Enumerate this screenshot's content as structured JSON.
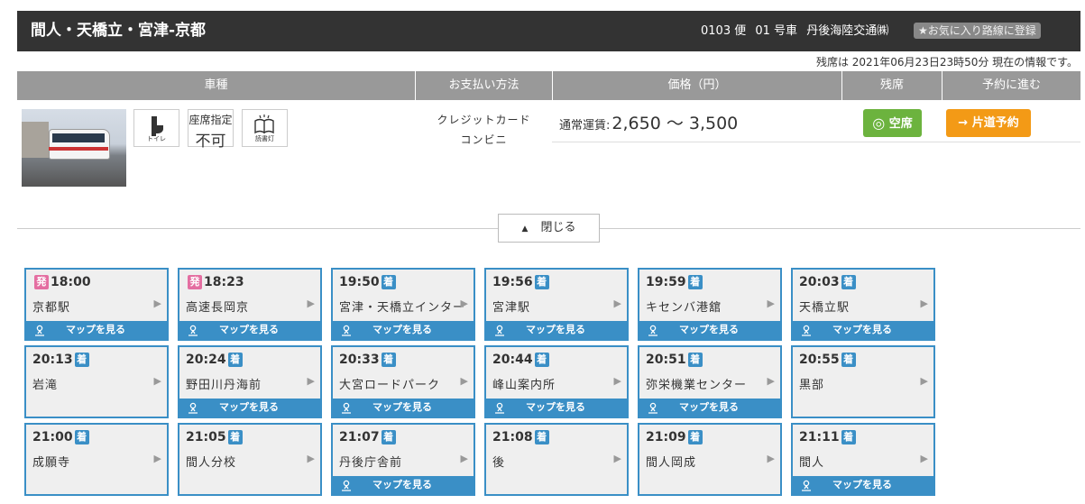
{
  "header": {
    "title": "間人・天橋立・宮津-京都",
    "flight_no": "0103 便",
    "car_no": "01 号車",
    "operator": "丹後海陸交通㈱",
    "favorite_label": "★お気に入り路線に登録"
  },
  "stock_info": "残席は 2021年06月23日23時50分 現在の情報です。",
  "table_headers": {
    "vehicle": "車種",
    "payment": "お支払い方法",
    "price": "価格（円）",
    "seats": "残席",
    "reserve": "予約に進む"
  },
  "facilities": {
    "toilet_label": "トイレ",
    "seat_line1": "座席指定",
    "seat_line2": "不可",
    "light_label": "読書灯"
  },
  "payment_methods": [
    "クレジットカード",
    "コンビニ"
  ],
  "price": {
    "label": "通常運賃:",
    "amount": "2,650 〜 3,500"
  },
  "seat_status": "空席",
  "reserve_button": "片道予約",
  "close_button": "閉じる",
  "map_label": "マップを見る",
  "stops": [
    {
      "time": "18:00",
      "tag": "発",
      "kind": "dep",
      "name": "京都駅",
      "map": true
    },
    {
      "time": "18:23",
      "tag": "発",
      "kind": "dep",
      "name": "高速長岡京",
      "map": true
    },
    {
      "time": "19:50",
      "tag": "着",
      "kind": "arr",
      "name": "宮津・天橋立インター",
      "map": true
    },
    {
      "time": "19:56",
      "tag": "着",
      "kind": "arr",
      "name": "宮津駅",
      "map": true
    },
    {
      "time": "19:59",
      "tag": "着",
      "kind": "arr",
      "name": "キセンバ港舘",
      "map": true
    },
    {
      "time": "20:03",
      "tag": "着",
      "kind": "arr",
      "name": "天橋立駅",
      "map": true
    },
    {
      "time": "20:13",
      "tag": "着",
      "kind": "arr",
      "name": "岩滝",
      "map": false
    },
    {
      "time": "20:24",
      "tag": "着",
      "kind": "arr",
      "name": "野田川丹海前",
      "map": true
    },
    {
      "time": "20:33",
      "tag": "着",
      "kind": "arr",
      "name": "大宮ロードパーク",
      "map": true
    },
    {
      "time": "20:44",
      "tag": "着",
      "kind": "arr",
      "name": "峰山案内所",
      "map": true
    },
    {
      "time": "20:51",
      "tag": "着",
      "kind": "arr",
      "name": "弥栄機業センター",
      "map": true
    },
    {
      "time": "20:55",
      "tag": "着",
      "kind": "arr",
      "name": "黒部",
      "map": false
    },
    {
      "time": "21:00",
      "tag": "着",
      "kind": "arr",
      "name": "成願寺",
      "map": false
    },
    {
      "time": "21:05",
      "tag": "着",
      "kind": "arr",
      "name": "間人分校",
      "map": false
    },
    {
      "time": "21:07",
      "tag": "着",
      "kind": "arr",
      "name": "丹後庁舎前",
      "map": true
    },
    {
      "time": "21:08",
      "tag": "着",
      "kind": "arr",
      "name": "後",
      "map": false
    },
    {
      "time": "21:09",
      "tag": "着",
      "kind": "arr",
      "name": "間人岡成",
      "map": false
    },
    {
      "time": "21:11",
      "tag": "着",
      "kind": "arr",
      "name": "間人",
      "map": true
    }
  ]
}
